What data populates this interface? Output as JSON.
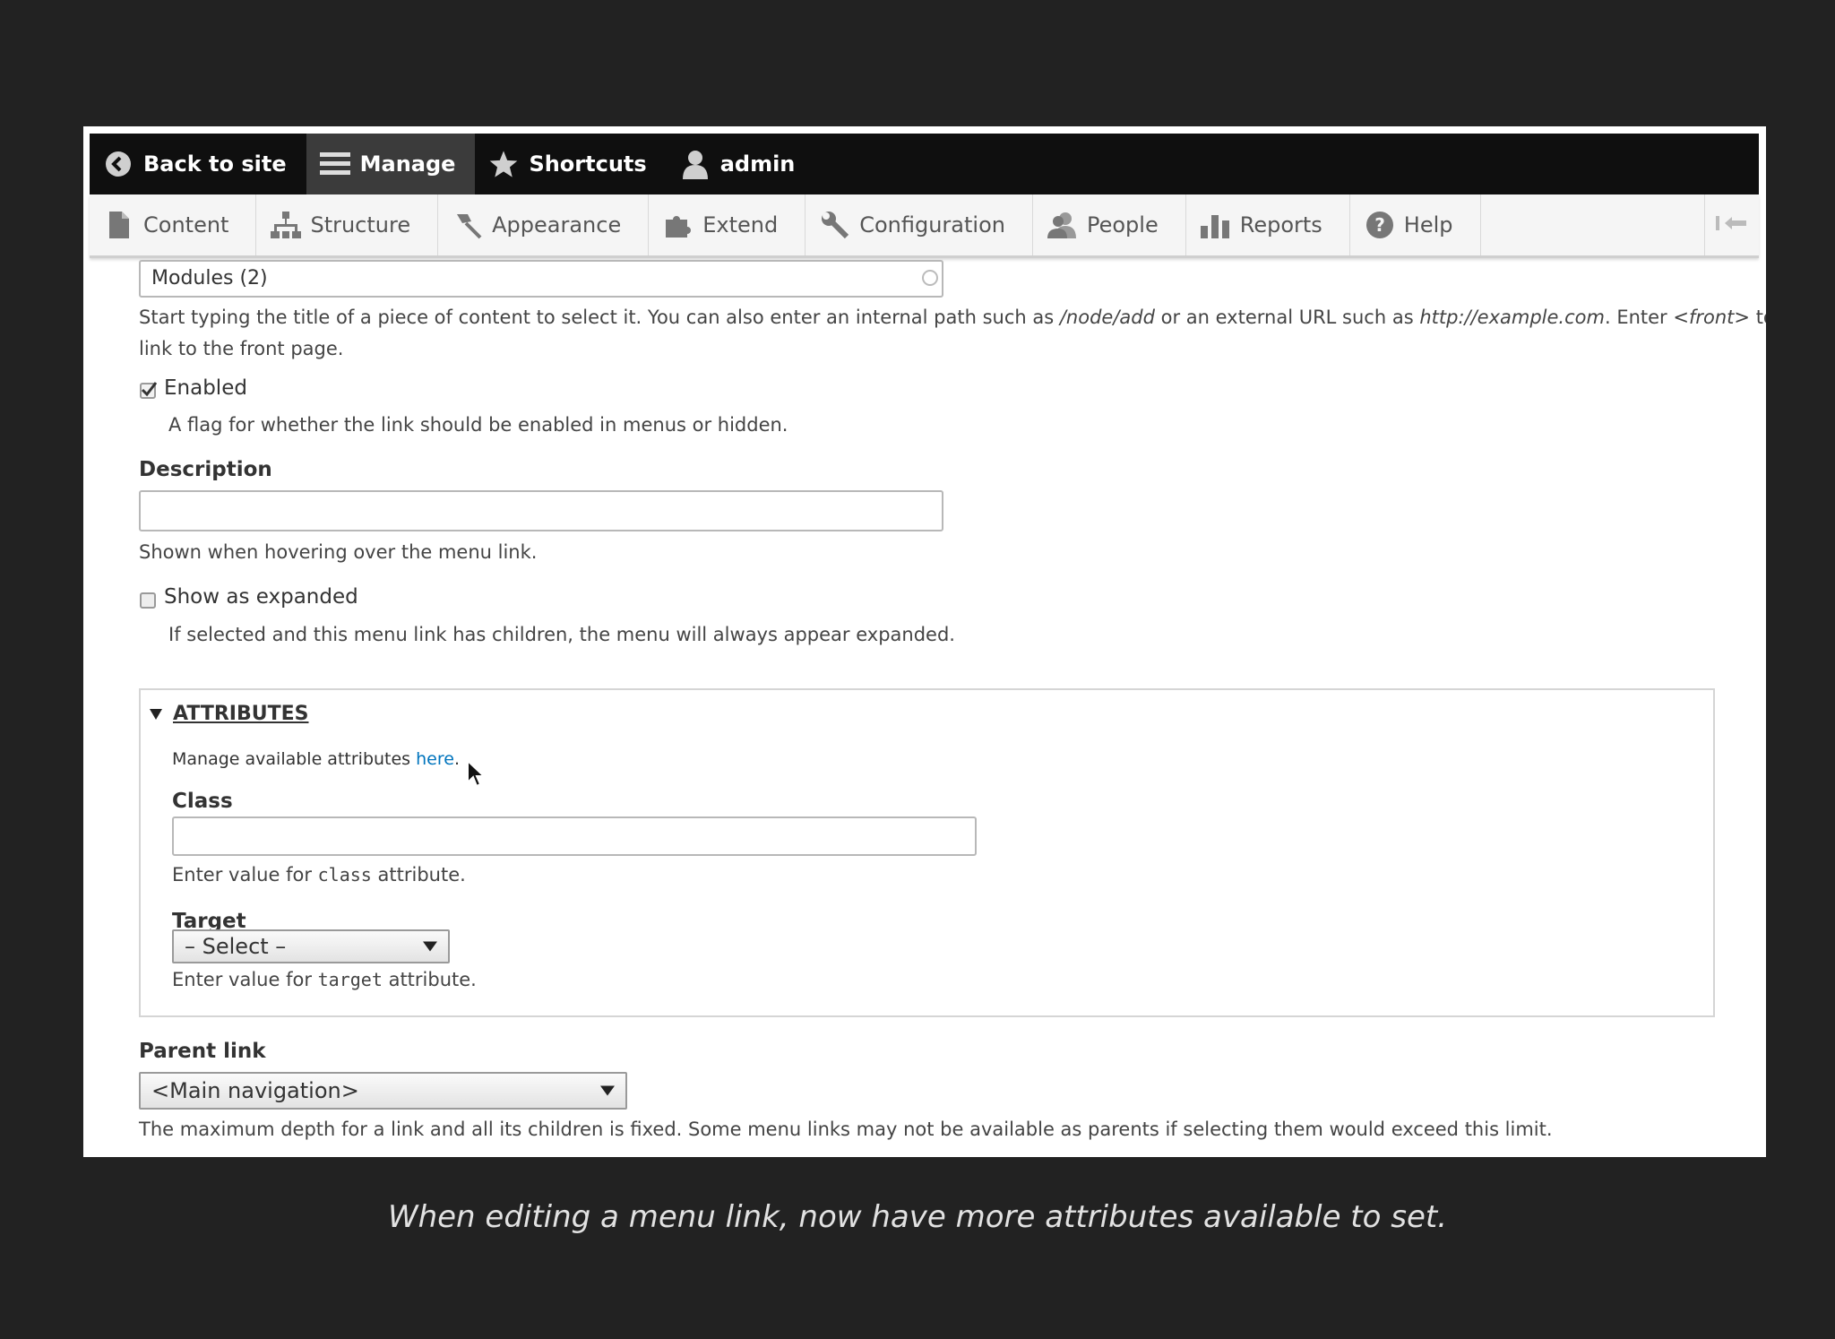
{
  "toolbar": {
    "back_label": "Back to site",
    "manage_label": "Manage",
    "shortcuts_label": "Shortcuts",
    "user_label": "admin"
  },
  "tray": {
    "items": [
      {
        "label": "Content",
        "icon": "file-icon"
      },
      {
        "label": "Structure",
        "icon": "sitemap-icon"
      },
      {
        "label": "Appearance",
        "icon": "paintbrush-icon"
      },
      {
        "label": "Extend",
        "icon": "puzzle-icon"
      },
      {
        "label": "Configuration",
        "icon": "wrench-icon"
      },
      {
        "label": "People",
        "icon": "people-icon"
      },
      {
        "label": "Reports",
        "icon": "bar-chart-icon"
      },
      {
        "label": "Help",
        "icon": "help-icon"
      }
    ]
  },
  "link_field": {
    "value": "Modules (2)",
    "desc_part1": "Start typing the title of a piece of content to select it. You can also enter an internal path such as",
    "path_example": "/node/add",
    "desc_part2": "or an external URL such as",
    "url_example": "http://example.com",
    "desc_part3": ". Enter",
    "front_example": "<front>",
    "desc_part4": "to link to the front page."
  },
  "enabled": {
    "label": "Enabled",
    "checked": true,
    "desc": "A flag for whether the link should be enabled in menus or hidden."
  },
  "description": {
    "label": "Description",
    "value": "",
    "desc": "Shown when hovering over the menu link."
  },
  "expanded": {
    "label": "Show as expanded",
    "checked": false,
    "desc": "If selected and this menu link has children, the menu will always appear expanded."
  },
  "attributes": {
    "legend": "ATTRIBUTES",
    "manage_text": "Manage available attributes",
    "manage_link": "here",
    "manage_end": ".",
    "class_label": "Class",
    "class_value": "",
    "class_desc_pre": "Enter value for",
    "class_desc_code": "class",
    "class_desc_post": "attribute.",
    "target_label": "Target",
    "target_selected": "– Select –",
    "target_desc_pre": "Enter value for",
    "target_desc_code": "target",
    "target_desc_post": "attribute."
  },
  "parent": {
    "label": "Parent link",
    "selected": "<Main navigation>",
    "desc": "The maximum depth for a link and all its children is fixed. Some menu links may not be available as parents if selecting them would exceed this limit."
  },
  "caption": "When editing a menu link, now have more attributes available to set.",
  "colors": {
    "background": "#222222",
    "toolbar": "#0f0f0f",
    "active_tab": "#3b3b3b",
    "link": "#0074bd"
  }
}
